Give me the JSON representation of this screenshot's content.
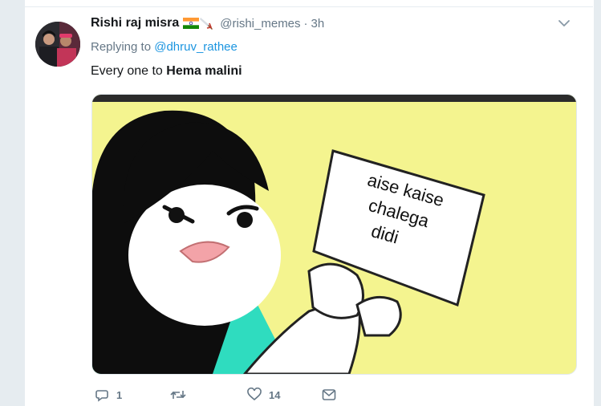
{
  "tweet": {
    "display_name": "Rishi raj misra",
    "handle": "@rishi_memes",
    "separator": "·",
    "time": "3h",
    "replying_prefix": "Replying to",
    "replying_to": "@dhruv_rathee",
    "text_prefix": "Every one to",
    "text_bold": "Hema malini"
  },
  "media": {
    "paper_line1": "aise kaise",
    "paper_line2": "chalega",
    "paper_line3": "didi"
  },
  "actions": {
    "reply_count": "1",
    "retweet_count": "",
    "like_count": "14"
  },
  "icons": {
    "caret": "chevron-down-icon",
    "reply": "reply-icon",
    "retweet": "retweet-icon",
    "like": "heart-icon",
    "dm": "message-icon"
  },
  "colors": {
    "link": "#1b95e0",
    "secondary_text": "#657786",
    "primary_text": "#14171a",
    "meme_background": "#f4f48f",
    "shirt": "#2fdcbf"
  }
}
